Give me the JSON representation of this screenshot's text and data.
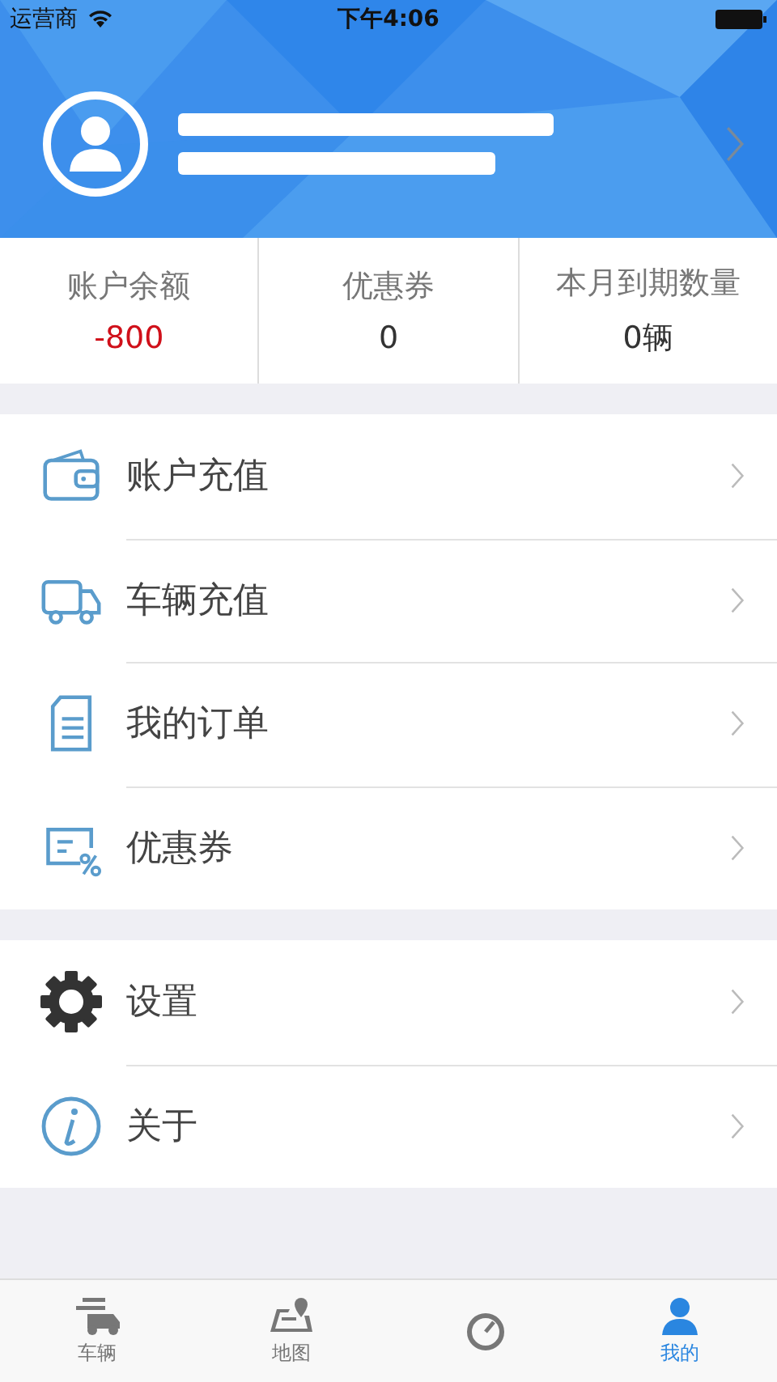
{
  "status_bar": {
    "carrier": "运营商",
    "time": "下午4:06"
  },
  "profile": {
    "redacted": true
  },
  "stats": [
    {
      "label": "账户余额",
      "value": "-800",
      "kind": "negative"
    },
    {
      "label": "优惠券",
      "value": "0",
      "kind": "normal"
    },
    {
      "label": "本月到期数量",
      "value": "0辆",
      "kind": "normal"
    }
  ],
  "menu_groups": [
    [
      {
        "label": "账户充值",
        "kind": "wallet"
      },
      {
        "label": "车辆充值",
        "kind": "truck"
      },
      {
        "label": "我的订单",
        "kind": "document"
      },
      {
        "label": "优惠券",
        "kind": "coupon"
      }
    ],
    [
      {
        "label": "设置",
        "kind": "settings"
      },
      {
        "label": "关于",
        "kind": "info"
      }
    ]
  ],
  "tab_bar": [
    {
      "label": "车辆",
      "kind": "truck",
      "selected": false
    },
    {
      "label": "地图",
      "kind": "map",
      "selected": false
    },
    {
      "kind": "dial",
      "selected": false
    },
    {
      "label": "我的",
      "kind": "person",
      "selected": true
    }
  ]
}
